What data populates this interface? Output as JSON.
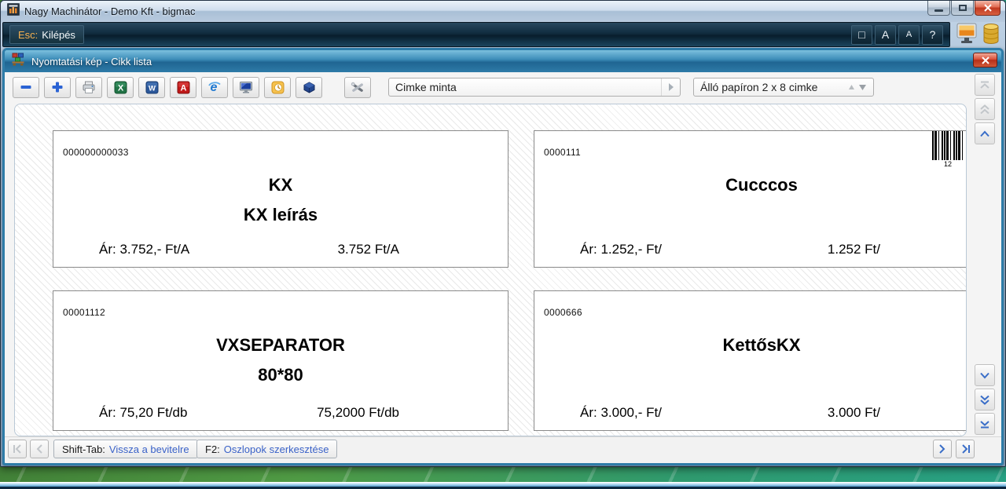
{
  "main_window": {
    "title": "Nagy Machinátor - Demo Kft - bigmac"
  },
  "command_bar": {
    "exit_key": "Esc:",
    "exit_label": "Kilépés",
    "window_button": "□",
    "font_large_button": "A",
    "font_small_button": "A",
    "help_button": "?"
  },
  "preview_window": {
    "title": "Nyomtatási kép - Cikk lista",
    "toolbar": {
      "icons": [
        "zoom-out",
        "zoom-in",
        "print",
        "export-excel",
        "export-word",
        "export-pdf",
        "open-browser",
        "send-to-screen",
        "outlook-schedule",
        "archive",
        "settings"
      ],
      "icon_glyphs": {
        "excel": "X",
        "word": "W",
        "pdf": "A",
        "browser": "e"
      },
      "template_selector_value": "Cimke minta",
      "paper_selector_value": "Álló papíron 2 x 8 cimke"
    },
    "labels": [
      {
        "code": "000000000033",
        "name": "KX",
        "description": "KX leírás",
        "price_left": "Ár: 3.752,- Ft/A",
        "price_right": "3.752 Ft/A"
      },
      {
        "code": "0000111",
        "name": "Cucccos",
        "description": "",
        "price_left": "Ár: 1.252,- Ft/",
        "price_right": "1.252 Ft/",
        "barcode_number": "12"
      },
      {
        "code": "00001112",
        "name": "VXSEPARATOR",
        "description": "80*80",
        "price_left": "Ár: 75,20 Ft/db",
        "price_right": "75,2000 Ft/db"
      },
      {
        "code": "0000666",
        "name": "KettősKX",
        "description": "",
        "price_left": "Ár: 3.000,- Ft/",
        "price_right": "3.000 Ft/"
      }
    ],
    "footer": {
      "shift_tab_key": "Shift-Tab:",
      "shift_tab_label": "Vissza a bevitelre",
      "f2_key": "F2:",
      "f2_label": "Oszlopok szerkesztése"
    }
  },
  "colors": {
    "accent_frame": "#2e7ca8",
    "command_key_orange": "#f5b050",
    "footer_link_blue": "#3a62c8",
    "close_red": "#c03820"
  }
}
